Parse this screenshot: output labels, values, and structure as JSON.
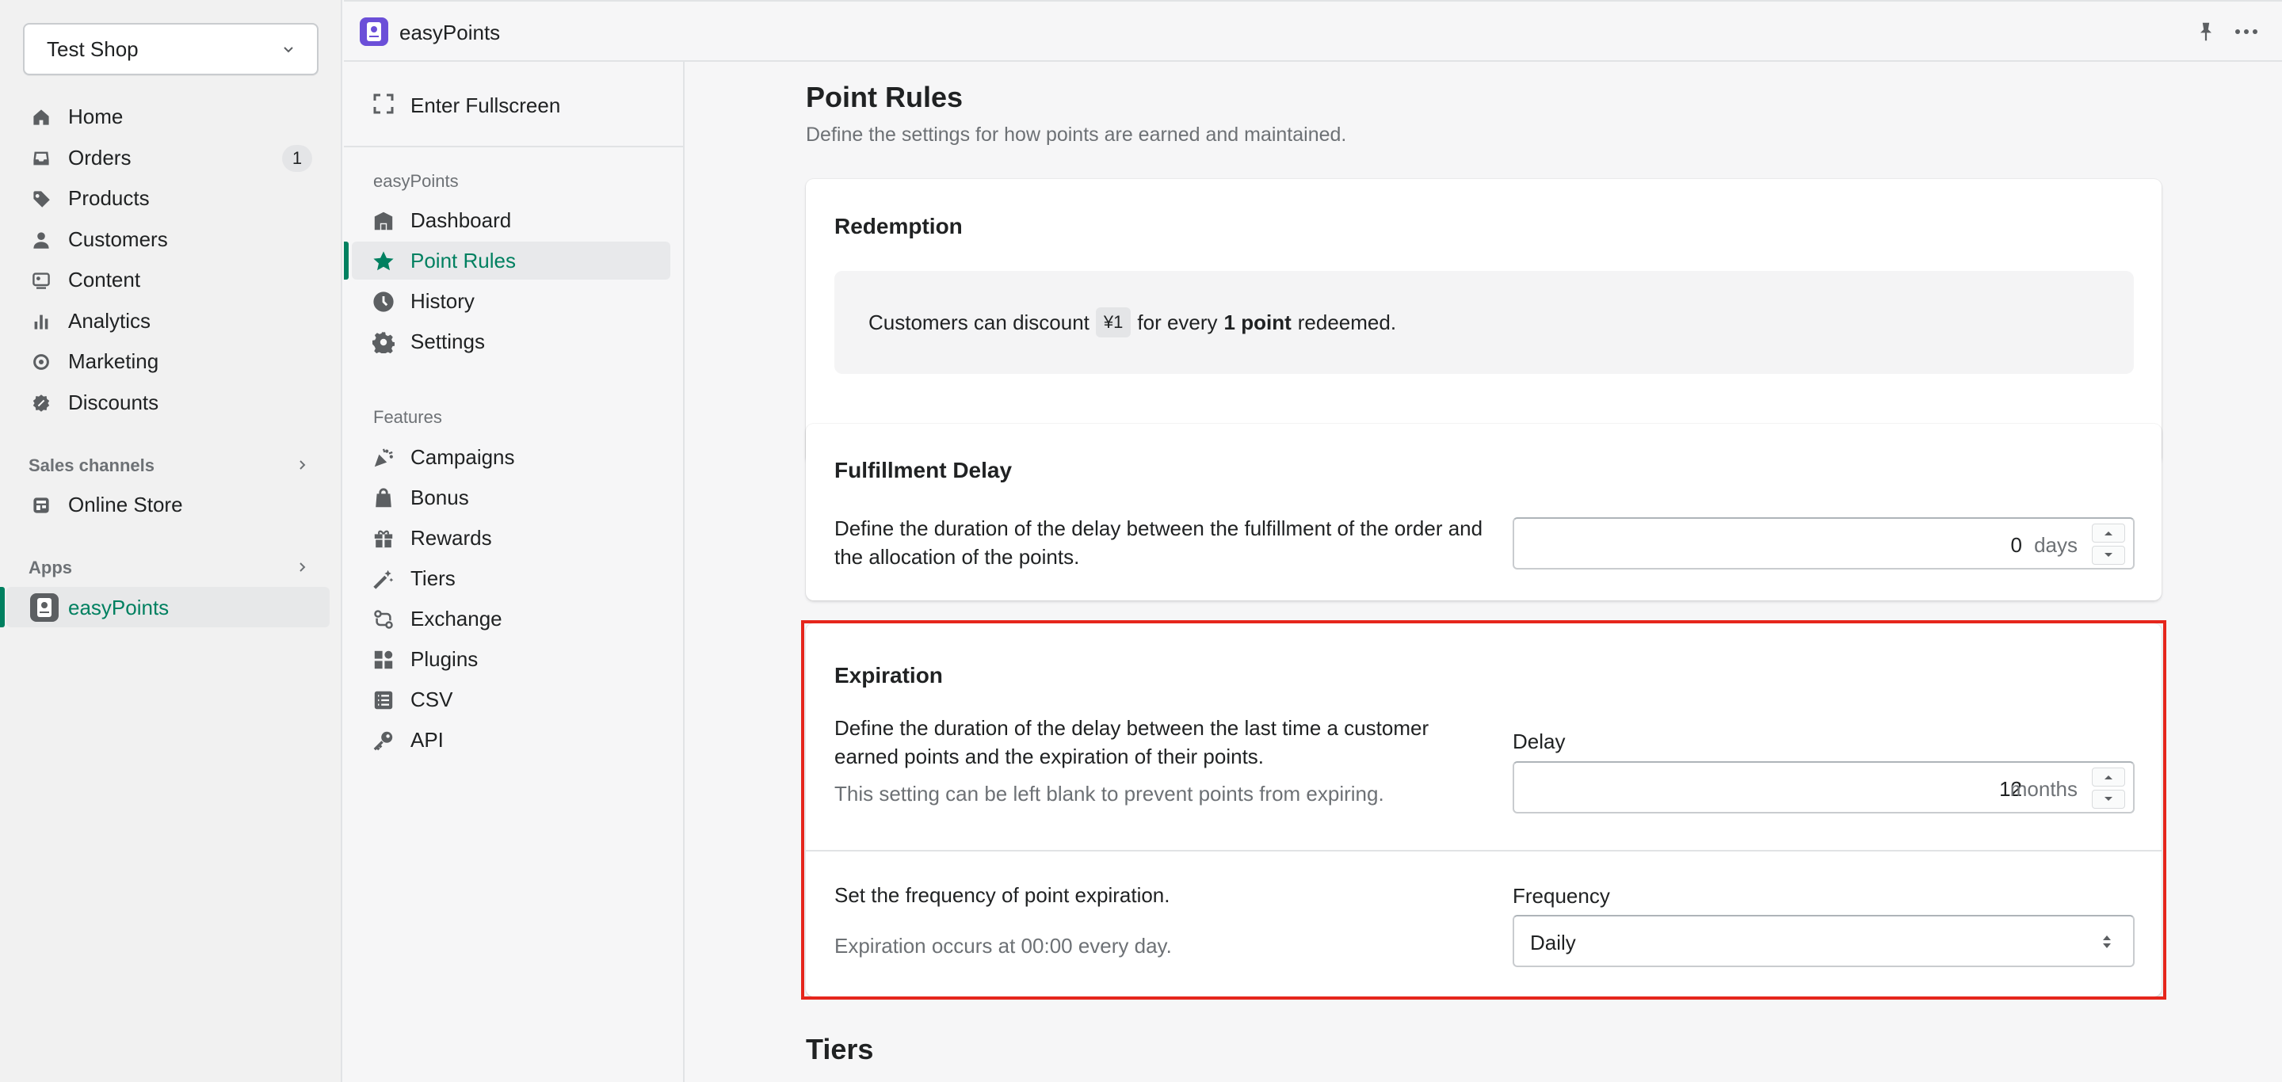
{
  "admin_nav": {
    "shop_name": "Test Shop",
    "items": [
      {
        "label": "Home",
        "icon": "home-icon"
      },
      {
        "label": "Orders",
        "icon": "orders-icon",
        "badge": "1"
      },
      {
        "label": "Products",
        "icon": "tag-icon"
      },
      {
        "label": "Customers",
        "icon": "person-icon"
      },
      {
        "label": "Content",
        "icon": "content-icon"
      },
      {
        "label": "Analytics",
        "icon": "bar-chart-icon"
      },
      {
        "label": "Marketing",
        "icon": "target-icon"
      },
      {
        "label": "Discounts",
        "icon": "discount-icon"
      }
    ],
    "sales_channels_label": "Sales channels",
    "online_store_label": "Online Store",
    "apps_label": "Apps",
    "app_label": "easyPoints"
  },
  "topbar": {
    "title": "easyPoints"
  },
  "app_nav": {
    "fullscreen_label": "Enter Fullscreen",
    "section_easypoints": "easyPoints",
    "main_items": [
      {
        "label": "Dashboard",
        "icon": "dashboard-icon"
      },
      {
        "label": "Point Rules",
        "icon": "star-icon",
        "active": true
      },
      {
        "label": "History",
        "icon": "clock-icon"
      },
      {
        "label": "Settings",
        "icon": "gear-icon"
      }
    ],
    "section_features": "Features",
    "feature_items": [
      {
        "label": "Campaigns",
        "icon": "confetti-icon"
      },
      {
        "label": "Bonus",
        "icon": "bag-icon"
      },
      {
        "label": "Rewards",
        "icon": "gift-icon"
      },
      {
        "label": "Tiers",
        "icon": "wand-icon"
      },
      {
        "label": "Exchange",
        "icon": "exchange-icon"
      },
      {
        "label": "Plugins",
        "icon": "plugins-icon"
      },
      {
        "label": "CSV",
        "icon": "list-icon"
      },
      {
        "label": "API",
        "icon": "key-icon"
      }
    ]
  },
  "page": {
    "title": "Point Rules",
    "subtitle": "Define the settings for how points are earned and maintained.",
    "redemption": {
      "title": "Redemption",
      "text_before": "Customers can discount",
      "amount": "¥1",
      "text_middle": "for every",
      "points": "1 point",
      "text_after": "redeemed."
    },
    "fulfillment": {
      "title": "Fulfillment Delay",
      "desc": "Define the duration of the delay between the fulfillment of the order and the allocation of the points.",
      "value": "0",
      "unit": "days"
    },
    "expiration": {
      "title": "Expiration",
      "desc": "Define the duration of the delay between the last time a customer earned points and the expiration of their points.",
      "hint": "This setting can be left blank to prevent points from expiring.",
      "delay_label": "Delay",
      "delay_value": "12",
      "delay_unit": "months",
      "frequency_desc": "Set the frequency of point expiration.",
      "frequency_hint": "Expiration occurs at 00:00 every day.",
      "frequency_label": "Frequency",
      "frequency_value": "Daily"
    },
    "tiers_title": "Tiers"
  },
  "colors": {
    "accent": "#008060",
    "highlight": "#e5261c",
    "app_icon": "#6b4fd8"
  }
}
